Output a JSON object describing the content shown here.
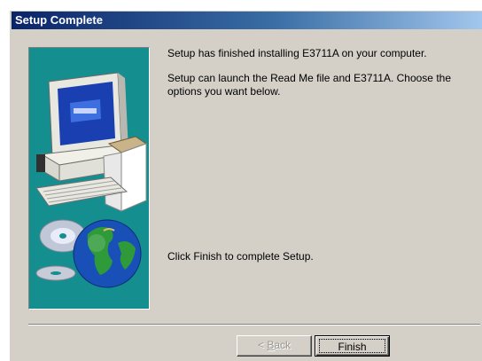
{
  "window": {
    "title": "Setup Complete"
  },
  "content": {
    "line1": "Setup has finished installing E3711A on your computer.",
    "line2": "Setup can launch the Read Me file and E3711A.  Choose the options you want below.",
    "line3": "Click Finish to complete Setup."
  },
  "buttons": {
    "back_prefix": "< ",
    "back_mnemonic": "B",
    "back_rest": "ack",
    "finish_label": "Finish"
  },
  "icons": {
    "illustration": "computer-cd-globe-icon"
  },
  "colors": {
    "title_bar_start": "#0a246a",
    "title_bar_end": "#a6caf0",
    "panel_teal": "#148e8e",
    "dialog_gray": "#d4d0c8"
  }
}
